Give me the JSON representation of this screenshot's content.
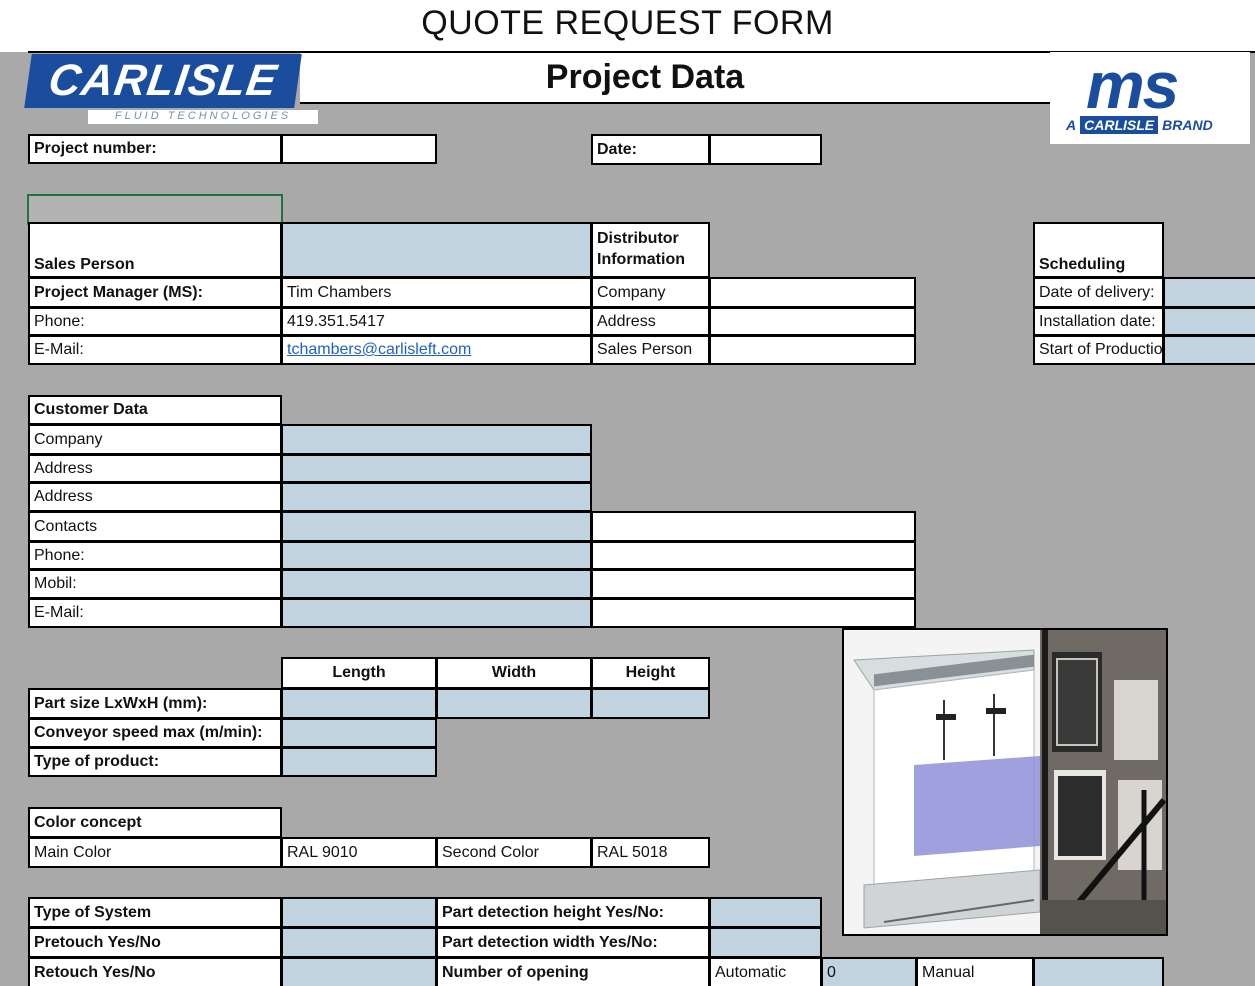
{
  "title": "QUOTE REQUEST FORM",
  "logos": {
    "carlisle": {
      "name": "CARLISLE",
      "tagline": "FLUID TECHNOLOGIES"
    },
    "ms": {
      "name": "ms",
      "prefix": "A",
      "badge": "CARLISLE",
      "suffix": "BRAND"
    }
  },
  "project_data_title": "Project Data",
  "project": {
    "number_label": "Project number:",
    "number_value": "",
    "date_label": "Date:",
    "date_value": ""
  },
  "sales": {
    "sales_person_label": "Sales Person",
    "sales_person_value": "",
    "pm_label": "Project Manager (MS):",
    "pm_value": "Tim Chambers",
    "phone_label": "Phone:",
    "phone_value": "419.351.5417",
    "email_label": "E-Mail:",
    "email_value": "tchambers@carlisleft.com"
  },
  "distributor": {
    "header_line1": "Distributor",
    "header_line2": "Information",
    "company_label": "Company",
    "address_label": "Address",
    "sales_person_label": "Sales Person"
  },
  "scheduling": {
    "header": "Scheduling",
    "delivery_label": "Date of delivery:",
    "installation_label": "Installation date:",
    "production_label": "Start of Production"
  },
  "customer": {
    "header": "Customer Data",
    "rows": [
      "Company",
      "Address",
      "Address",
      "Contacts",
      "Phone:",
      "Mobil:",
      "E-Mail:"
    ]
  },
  "dimensions": {
    "columns": [
      "Length",
      "Width",
      "Height"
    ],
    "part_size_label": "Part size LxWxH (mm):",
    "conveyor_label": "Conveyor speed max (m/min):",
    "product_label": "Type of product:"
  },
  "color": {
    "header": "Color concept",
    "main_label": "Main Color",
    "main_value": "RAL  9010",
    "second_label": "Second Color",
    "second_value": "RAL  5018"
  },
  "system": {
    "type_label": "Type of System",
    "pretouch_label": "Pretouch Yes/No",
    "retouch_label": "Retouch Yes/No",
    "detect_height_label": "Part detection height Yes/No:",
    "detect_width_label": "Part detection width Yes/No:",
    "opening_label": "Number of opening",
    "automatic_label": "Automatic",
    "automatic_value": "0",
    "manual_label": "Manual"
  },
  "colors": {
    "background": "#a9a9a9",
    "input_blue": "#c2d3e0",
    "brand_blue": "#1a4d9e",
    "link": "#1f5fc9"
  }
}
